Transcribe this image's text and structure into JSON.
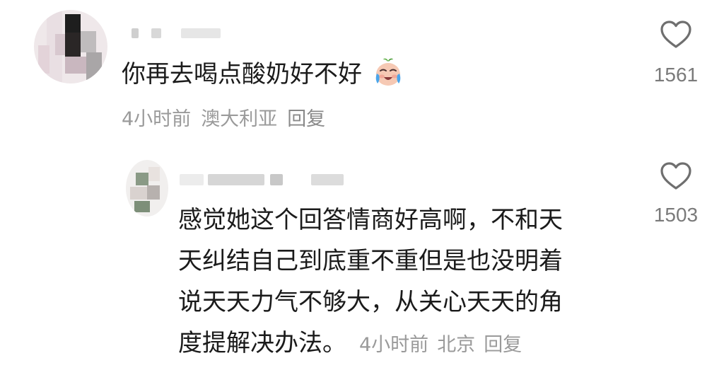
{
  "main_comment": {
    "text": "你再去喝点酸奶好不好",
    "emoji": "crying-face-emoji",
    "time": "4小时前",
    "location": "澳大利亚",
    "reply_label": "回复",
    "like_icon": "heart-outline-icon",
    "likes": "1561"
  },
  "reply_comment": {
    "lines": [
      "感觉她这个回答情商好高啊，不和天",
      "天纠结自己到底重不重但是也没明着",
      "说天天力气不够大，从关心天天的角",
      "度提解决办法。"
    ],
    "time": "4小时前",
    "location": "北京",
    "reply_label": "回复",
    "like_icon": "heart-outline-icon",
    "likes": "1503"
  },
  "colors": {
    "text_primary": "#1b1b1b",
    "text_secondary": "#9a9a9a",
    "icon": "#6f6f6f",
    "background": "#ffffff"
  }
}
